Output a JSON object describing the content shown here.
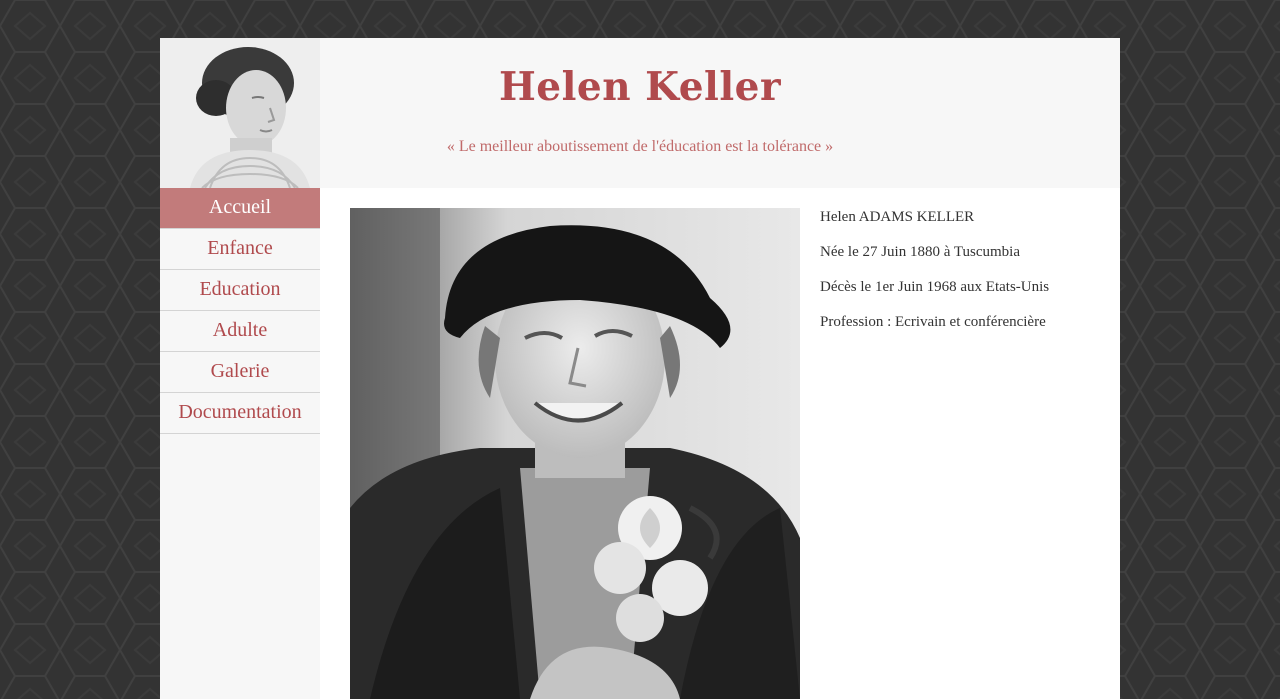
{
  "header": {
    "title": "Helen Keller",
    "quote": "« Le meilleur aboutissement de l'éducation est la tolérance »"
  },
  "nav": {
    "items": [
      {
        "label": "Accueil",
        "active": true
      },
      {
        "label": "Enfance",
        "active": false
      },
      {
        "label": "Education",
        "active": false
      },
      {
        "label": "Adulte",
        "active": false
      },
      {
        "label": "Galerie",
        "active": false
      },
      {
        "label": "Documentation",
        "active": false
      }
    ]
  },
  "info": {
    "name": "Helen ADAMS KELLER",
    "birth": "Née le 27 Juin 1880 à Tuscumbia",
    "death": "Décès le 1er Juin 1968 aux Etats-Unis",
    "profession": "Profession : Ecrivain et conférencière"
  },
  "colors": {
    "accent": "#b04a4d",
    "nav_active_bg": "#c27b7b",
    "background": "#333333",
    "header_bg": "#f7f7f7"
  }
}
